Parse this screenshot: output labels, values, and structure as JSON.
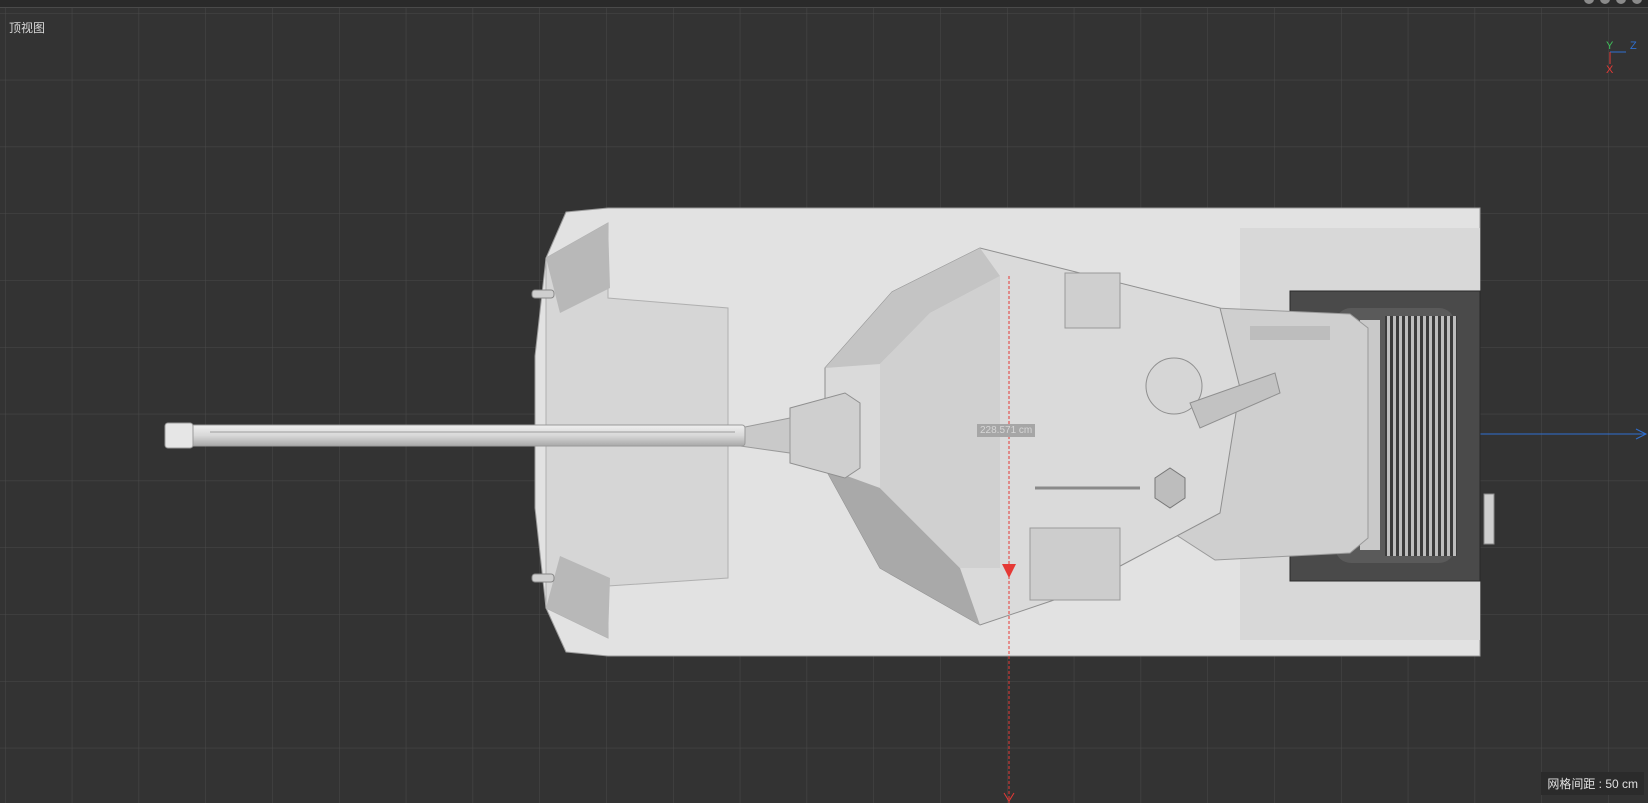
{
  "viewport": {
    "view_name": "顶视图",
    "grid_spacing_label": "网格间距 : 50 cm",
    "measurement_label": "228.571 cm"
  },
  "axis_gizmo": {
    "y": "Y",
    "z": "Z",
    "x": "X"
  },
  "colors": {
    "background": "#333333",
    "grid_line": "#4a4a4a",
    "model_gray": "#dcdcdc",
    "measure_red": "#e53935",
    "axis_blue": "#2f6fd0",
    "axis_green": "#3fbf5a"
  },
  "icons": {
    "window_menu": "menu-icon",
    "window_controls": [
      "circle-icon",
      "arrow-icon",
      "refresh-icon",
      "maximize-icon"
    ]
  }
}
